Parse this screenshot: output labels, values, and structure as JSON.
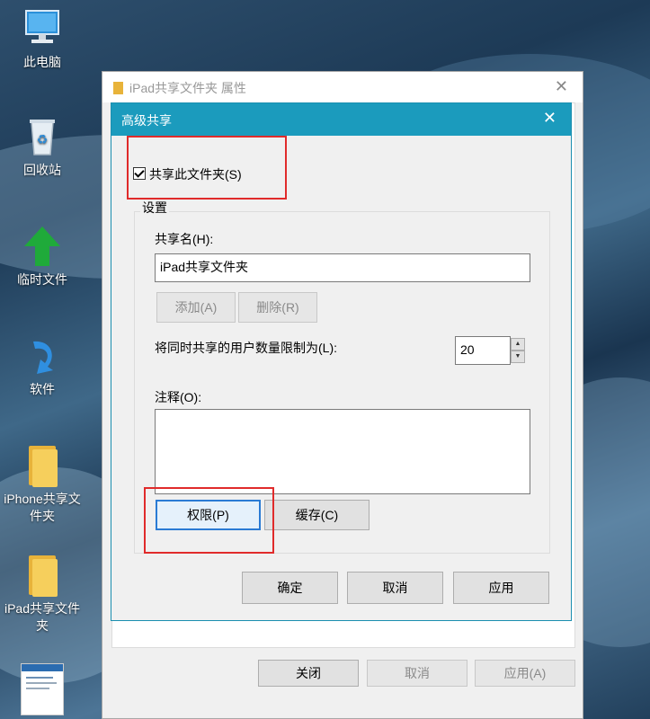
{
  "desktop": {
    "icons": [
      {
        "label": "此电脑",
        "icon": "computer-icon"
      },
      {
        "label": "回收站",
        "icon": "recycle-bin-icon"
      },
      {
        "label": "临时文件",
        "icon": "green-arrow-icon"
      },
      {
        "label": "软件",
        "icon": "blue-arrow-icon"
      },
      {
        "label": "iPhone共享文件夹",
        "icon": "folder-icon"
      },
      {
        "label": "iPad共享文件夹",
        "icon": "folder-icon"
      },
      {
        "label": "",
        "icon": "document-thumbnail-icon"
      }
    ]
  },
  "properties_window": {
    "title": "iPad共享文件夹 属性",
    "buttons": {
      "close": "关闭",
      "cancel": "取消",
      "apply": "应用(A)"
    }
  },
  "dialog": {
    "title": "高级共享",
    "share_checkbox": {
      "label": "共享此文件夹(S)",
      "checked": true
    },
    "settings_group": "设置",
    "share_name_label": "共享名(H):",
    "share_name_value": "iPad共享文件夹",
    "add_button": "添加(A)",
    "remove_button": "删除(R)",
    "limit_label": "将同时共享的用户数量限制为(L):",
    "limit_value": "20",
    "comment_label": "注释(O):",
    "comment_value": "",
    "permissions_button": "权限(P)",
    "caching_button": "缓存(C)",
    "ok_button": "确定",
    "cancel_button": "取消",
    "apply_button": "应用"
  },
  "colors": {
    "titlebar": "#1b9bbd",
    "highlight": "#e02b2b"
  }
}
